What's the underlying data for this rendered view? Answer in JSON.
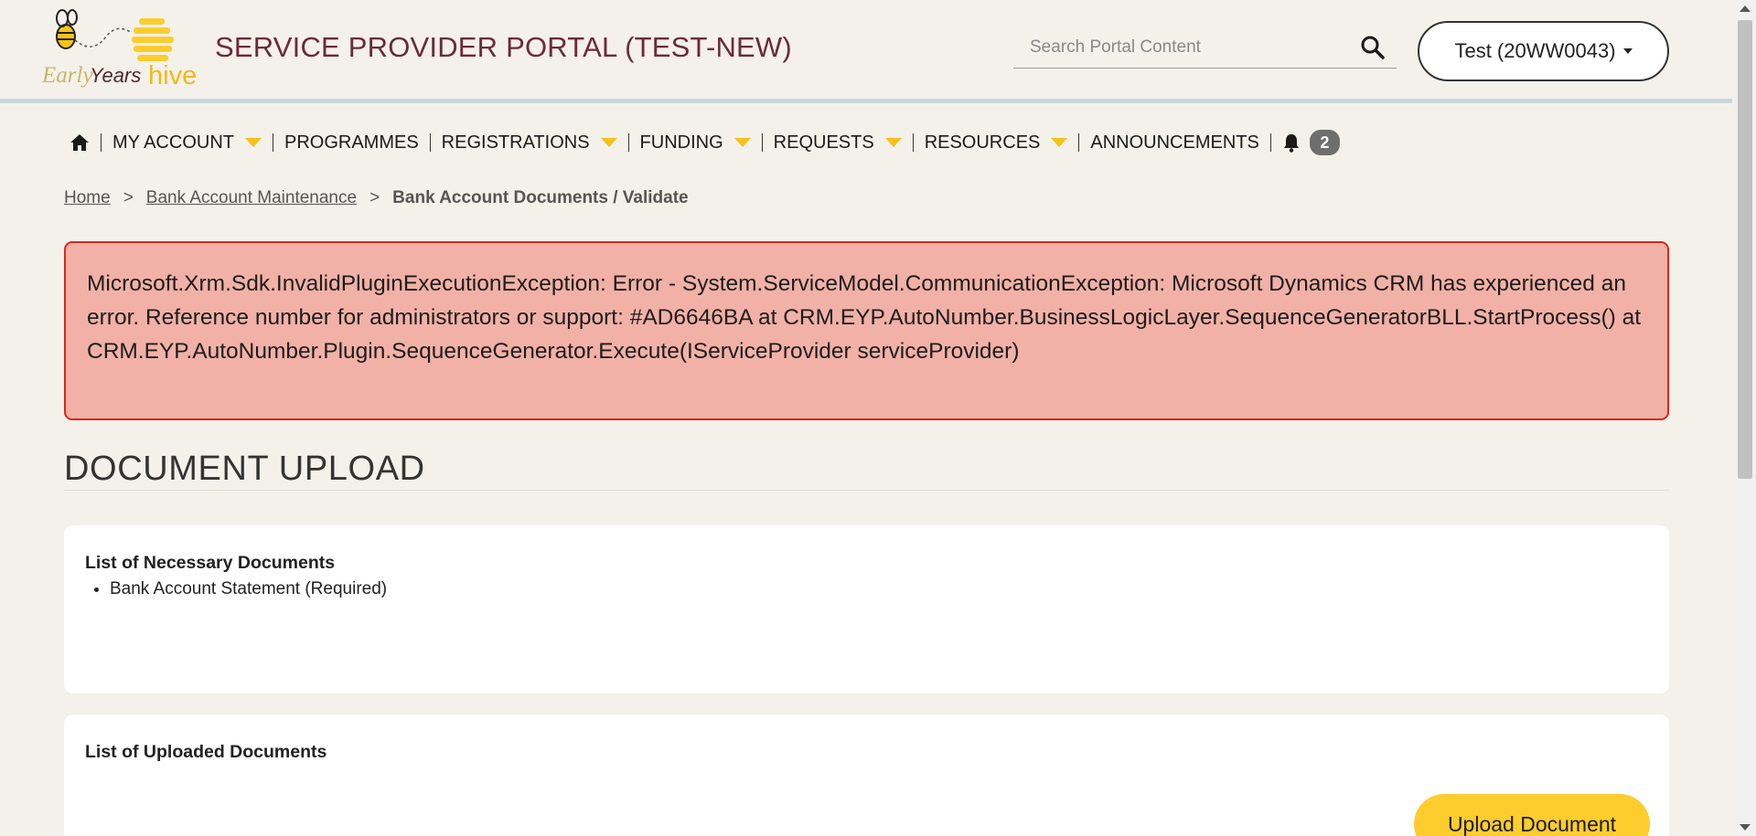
{
  "header": {
    "logo_text_early": "Early",
    "logo_text_years": "Years",
    "logo_text_hive": "hive",
    "portal_title": "SERVICE PROVIDER PORTAL (TEST-NEW)",
    "search_placeholder": "Search Portal Content",
    "account_label": "Test (20WW0043)"
  },
  "nav": {
    "items": [
      {
        "label": "MY ACCOUNT",
        "has_dropdown": true
      },
      {
        "label": "PROGRAMMES",
        "has_dropdown": false
      },
      {
        "label": "REGISTRATIONS",
        "has_dropdown": true
      },
      {
        "label": "FUNDING",
        "has_dropdown": true
      },
      {
        "label": "REQUESTS",
        "has_dropdown": true
      },
      {
        "label": "RESOURCES",
        "has_dropdown": true
      },
      {
        "label": "ANNOUNCEMENTS",
        "has_dropdown": false
      }
    ],
    "notification_count": "2"
  },
  "breadcrumb": {
    "home": "Home",
    "parent": "Bank Account Maintenance",
    "current": "Bank Account Documents / Validate",
    "separator": ">"
  },
  "alert": {
    "message": "Microsoft.Xrm.Sdk.InvalidPluginExecutionException: Error - System.ServiceModel.CommunicationException: Microsoft Dynamics CRM has experienced an error. Reference number for administrators or support: #AD6646BA at CRM.EYP.AutoNumber.BusinessLogicLayer.SequenceGeneratorBLL.StartProcess() at CRM.EYP.AutoNumber.Plugin.SequenceGenerator.Execute(IServiceProvider serviceProvider)"
  },
  "main": {
    "section_title": "DOCUMENT UPLOAD",
    "necessary_title": "List of Necessary Documents",
    "necessary_documents": [
      "Bank Account Statement (Required)"
    ],
    "uploaded_title": "List of Uploaded Documents",
    "upload_button": "Upload Document"
  },
  "colors": {
    "brand": "#6b2a3c",
    "accent": "#fdcd2e",
    "alert_bg": "#f2b1a6",
    "alert_border": "#d9281c",
    "page_bg": "#f4f1ea"
  }
}
